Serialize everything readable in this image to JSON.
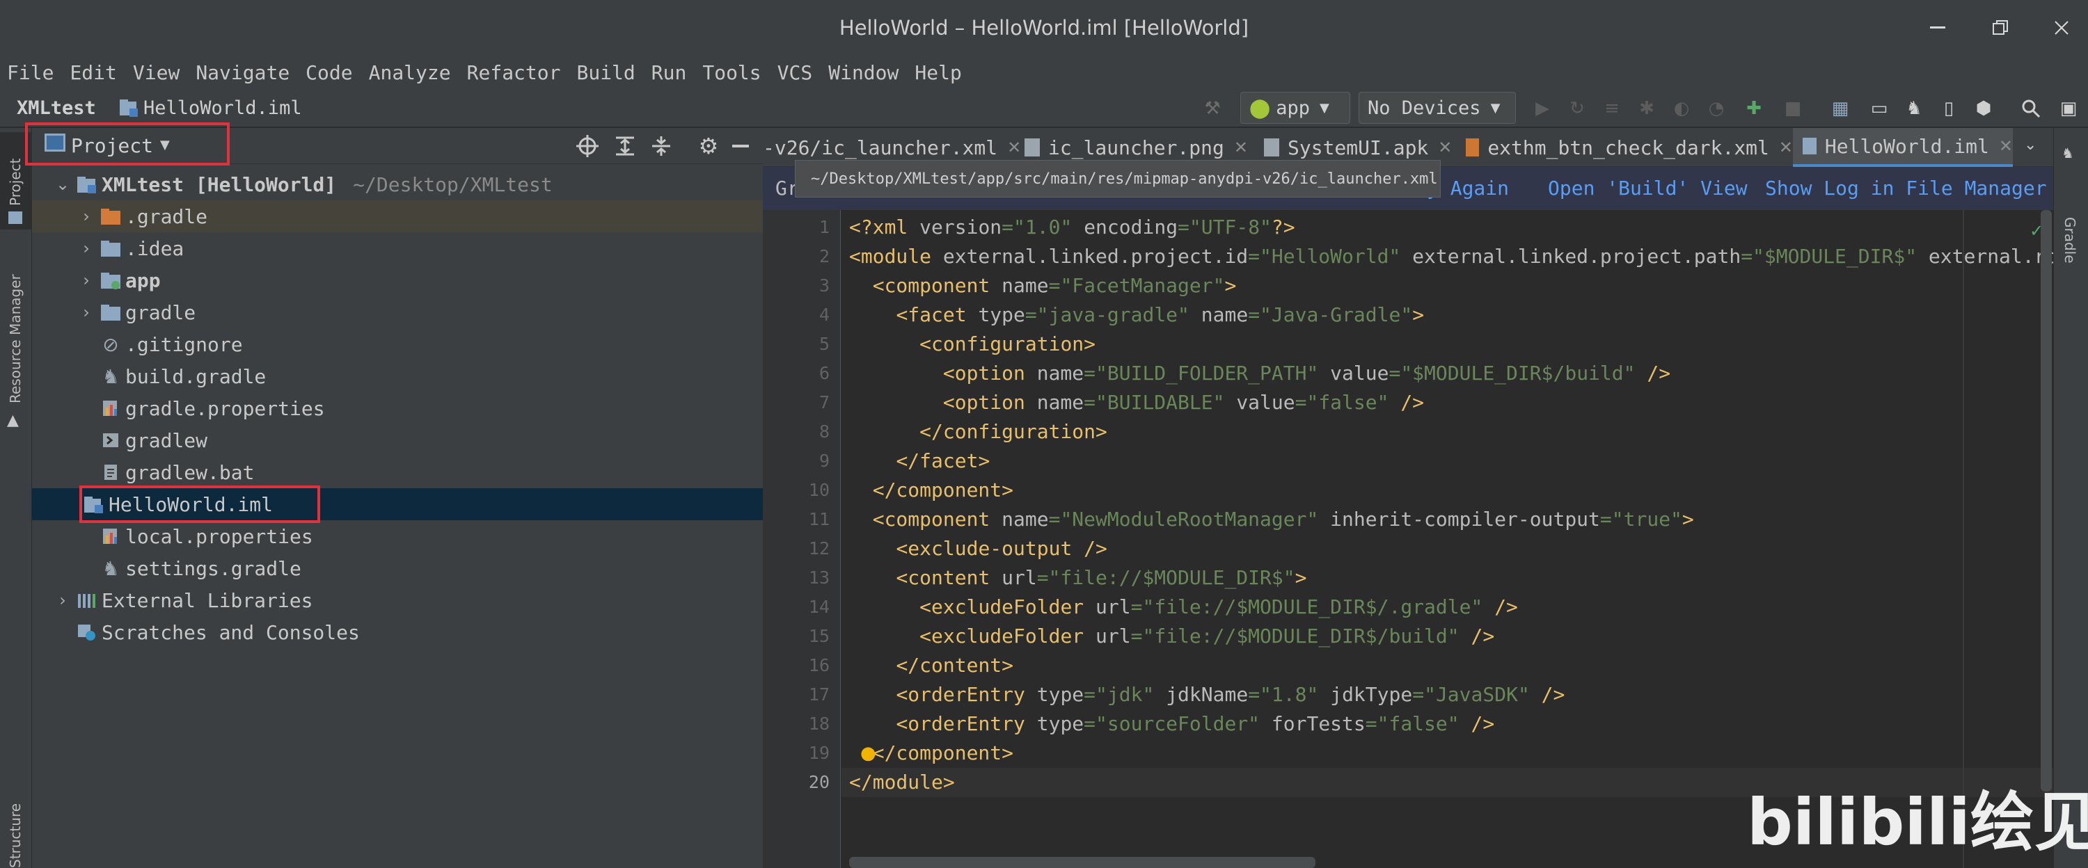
{
  "window": {
    "title": "HelloWorld – HelloWorld.iml [HelloWorld]"
  },
  "menu": [
    "File",
    "Edit",
    "View",
    "Navigate",
    "Code",
    "Analyze",
    "Refactor",
    "Build",
    "Run",
    "Tools",
    "VCS",
    "Window",
    "Help"
  ],
  "breadcrumb": {
    "project": "XMLtest",
    "file": "HelloWorld.iml"
  },
  "toolbar": {
    "run_config": "app",
    "devices": "No Devices"
  },
  "side_tools": {
    "left_top": "Project",
    "left_mid": "Resource Manager",
    "left_bottom": "Structure",
    "right": "Gradle"
  },
  "project_panel": {
    "view_label": "Project",
    "root_name": "XMLtest [HelloWorld]",
    "root_path": "~/Desktop/XMLtest",
    "items": [
      {
        "label": ".gradle"
      },
      {
        "label": ".idea"
      },
      {
        "label": "app"
      },
      {
        "label": "gradle"
      },
      {
        "label": ".gitignore"
      },
      {
        "label": "build.gradle"
      },
      {
        "label": "gradle.properties"
      },
      {
        "label": "gradlew"
      },
      {
        "label": "gradlew.bat"
      },
      {
        "label": "HelloWorld.iml"
      },
      {
        "label": "local.properties"
      },
      {
        "label": "settings.gradle"
      },
      {
        "label": "External Libraries"
      },
      {
        "label": "Scratches and Consoles"
      }
    ]
  },
  "tabs": [
    {
      "label": "-v26/ic_launcher.xml"
    },
    {
      "label": "ic_launcher.png"
    },
    {
      "label": "SystemUI.apk"
    },
    {
      "label": "exthm_btn_check_dark.xml"
    },
    {
      "label": "HelloWorld.iml"
    }
  ],
  "notification": {
    "left_fragment": "Gr",
    "try_again": "y Again",
    "open_build": "Open 'Build' View",
    "show_log": "Show Log in File Manager"
  },
  "tooltip": "~/Desktop/XMLtest/app/src/main/res/mipmap-anydpi-v26/ic_launcher.xml",
  "editor": {
    "line_numbers": [
      "1",
      "2",
      "3",
      "4",
      "5",
      "6",
      "7",
      "8",
      "9",
      "10",
      "11",
      "12",
      "13",
      "14",
      "15",
      "16",
      "17",
      "18",
      "19",
      "20"
    ]
  },
  "watermark": "bilibili绘见-"
}
